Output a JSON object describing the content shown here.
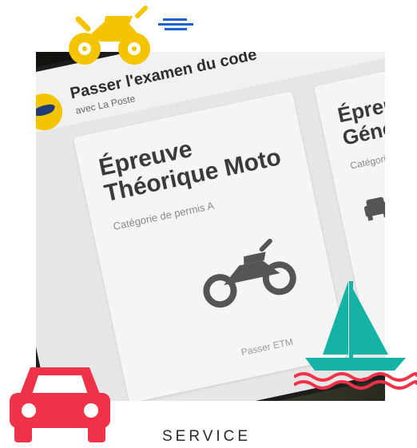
{
  "screen": {
    "header_title": "Passer l'examen du code",
    "header_subtitle": "avec La Poste"
  },
  "cards": [
    {
      "title": "Épreuve Théorique Moto",
      "subtitle": "Catégorie de permis A",
      "link": "Passer ETM",
      "icon": "motorcycle-icon"
    },
    {
      "title": "Épreuve Générale",
      "subtitle": "Catégorie de",
      "icon": "car-icon"
    }
  ],
  "decorations": {
    "motorcycle_color": "#f5c400",
    "speed_lines_color": "#1e64c8",
    "car_color": "#ee3247",
    "boat_sail_color": "#14b3a6",
    "boat_wave_color": "#ee3247"
  },
  "caption": "SERVICE"
}
